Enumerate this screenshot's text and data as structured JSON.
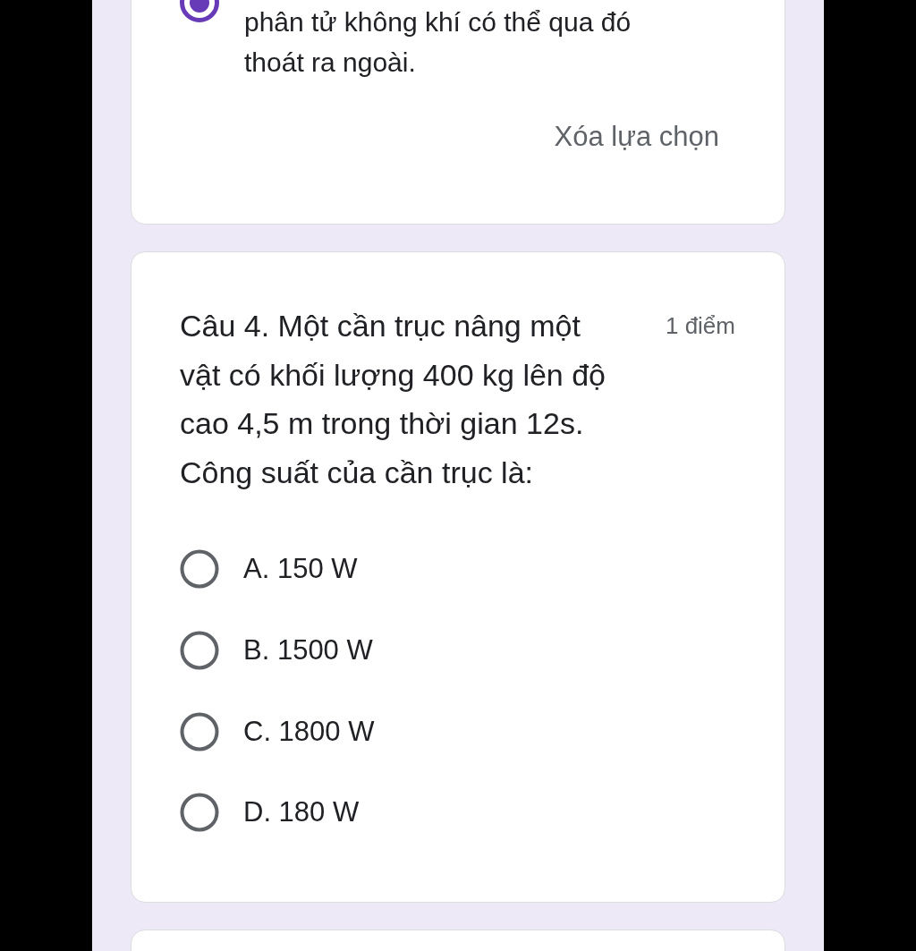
{
  "previous_question": {
    "options": [
      {
        "label": "phân tử không khí có thể qua đó thoát ra ngoài.",
        "selected": true
      }
    ],
    "clear_selection": "Xóa lựa chọn"
  },
  "question": {
    "title": "Câu 4. Một cần trục nâng một vật có khối lượng 400 kg lên độ cao 4,5 m trong thời gian 12s. Công suất của cần trục là:",
    "points": "1 điểm",
    "options": [
      {
        "label": "A. 150 W",
        "selected": false
      },
      {
        "label": "B. 1500 W",
        "selected": false
      },
      {
        "label": "C. 1800 W",
        "selected": false
      },
      {
        "label": "D. 180 W",
        "selected": false
      }
    ]
  }
}
